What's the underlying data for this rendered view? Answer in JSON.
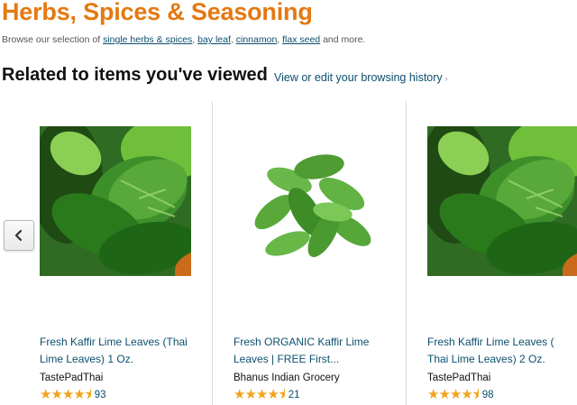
{
  "header": {
    "title": "Herbs, Spices & Seasoning",
    "browse_prefix": "Browse our selection of",
    "links": [
      "single herbs & spices",
      "bay leaf",
      "cinnamon",
      "flax seed"
    ],
    "browse_suffix": "and more."
  },
  "related": {
    "heading": "Related to items you've viewed",
    "history_link": "View or edit your browsing history",
    "history_caret": "›",
    "prev_icon": "chevron-left-icon",
    "items": [
      {
        "title_line1": "Fresh Kaffir Lime Leaves (Thai",
        "title_line2": "Lime Leaves) 1 Oz.",
        "seller": "TastePadThai",
        "rating": 4.5,
        "stars": "★★★★⯨",
        "review_count": "93"
      },
      {
        "title_line1": "Fresh ORGANIC Kaffir Lime",
        "title_line2": "Leaves | FREE First...",
        "seller": "Bhanus Indian Grocery",
        "rating": 4.5,
        "stars": "★★★★⯨",
        "review_count": "21"
      },
      {
        "title_line1": "Fresh Kaffir Lime Leaves (",
        "title_line2": "Thai Lime Leaves) 2 Oz.",
        "seller": "TastePadThai",
        "rating": 4.5,
        "stars": "★★★★⯨",
        "review_count": "98"
      }
    ]
  },
  "colors": {
    "title_orange": "#e47911",
    "link_blue": "#0b4f6e",
    "star_gold": "#f0a41c"
  }
}
